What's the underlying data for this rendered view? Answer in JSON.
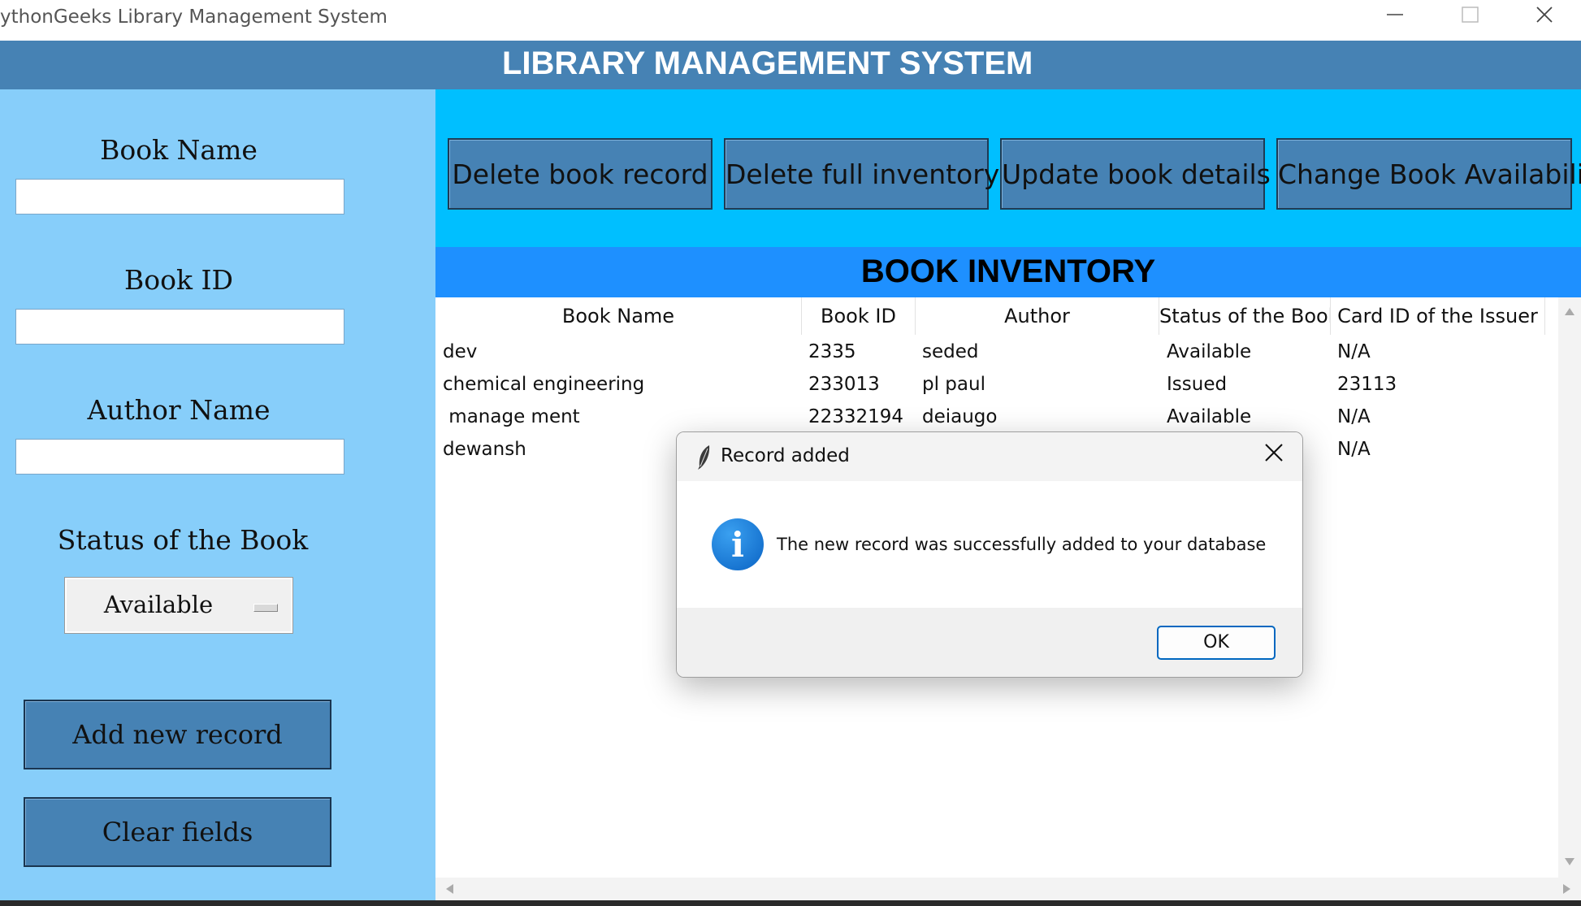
{
  "window": {
    "title": "ythonGeeks Library Management System",
    "minimize_icon": "minimize-icon",
    "maximize_icon": "maximize-icon",
    "close_icon": "close-icon"
  },
  "header": {
    "title": "LIBRARY MANAGEMENT SYSTEM"
  },
  "left_panel": {
    "book_name_label": "Book Name",
    "book_name_value": "",
    "book_id_label": "Book ID",
    "book_id_value": "",
    "author_label": "Author Name",
    "author_value": "",
    "status_label": "Status of the Book",
    "status_selected": "Available",
    "add_button": "Add new record",
    "clear_button": "Clear fields"
  },
  "toolbar": {
    "delete_record": "Delete book record",
    "delete_inventory": "Delete full inventory",
    "update_details": "Update book details",
    "change_availability": "Change Book Availability"
  },
  "inventory": {
    "title": "BOOK INVENTORY",
    "columns": [
      "Book Name",
      "Book ID",
      "Author",
      "Status of the Book",
      "Card ID of the Issuer"
    ],
    "rows": [
      [
        "dev",
        "2335",
        "seded",
        "Available",
        "N/A"
      ],
      [
        "chemical engineering",
        "233013",
        "pl paul",
        "Issued",
        "23113"
      ],
      [
        " manage ment",
        "22332194",
        "deiaugo",
        "Available",
        "N/A"
      ],
      [
        "dewansh",
        "",
        "",
        "",
        "N/A"
      ]
    ]
  },
  "dialog": {
    "title": "Record added",
    "title_icon": "feather-icon",
    "close_icon": "close-icon",
    "icon": "info-icon",
    "icon_glyph": "i",
    "message": "The new record was successfully added to your database",
    "ok_button": "OK"
  },
  "colors": {
    "header": "#4682B4",
    "left_panel": "#87CEFA",
    "toolbar_bg": "#00BFFF",
    "inventory_header": "#1E90FF",
    "button": "#4682B4",
    "dialog_ok_border": "#0067c0"
  }
}
